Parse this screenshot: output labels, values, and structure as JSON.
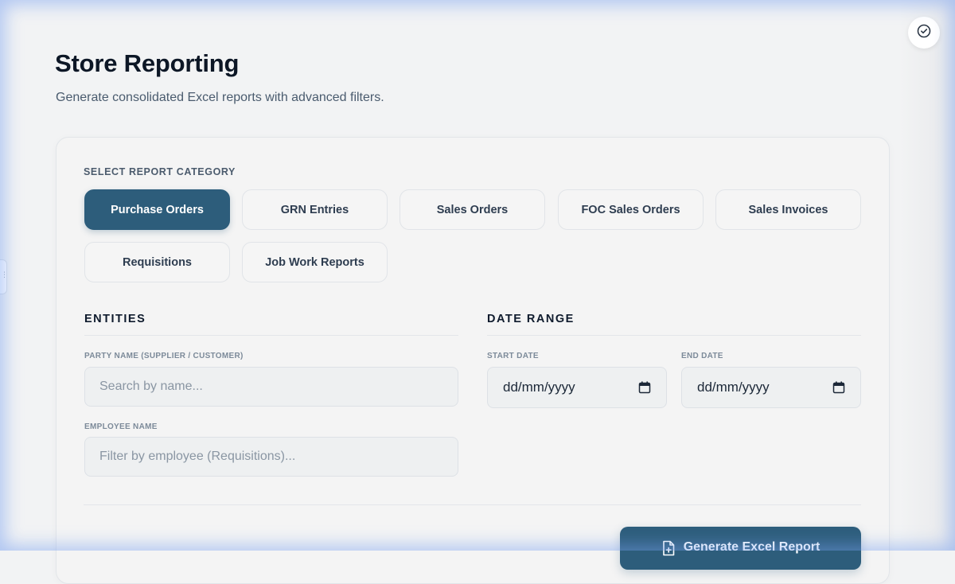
{
  "header": {
    "title": "Store Reporting",
    "subtitle": "Generate consolidated Excel reports with advanced filters."
  },
  "categories": {
    "caption": "SELECT REPORT CATEGORY",
    "selected": "Purchase Orders",
    "items": [
      {
        "label": "Purchase Orders"
      },
      {
        "label": "GRN Entries"
      },
      {
        "label": "Sales Orders"
      },
      {
        "label": "FOC Sales Orders"
      },
      {
        "label": "Sales Invoices"
      },
      {
        "label": "Requisitions"
      },
      {
        "label": "Job Work Reports"
      }
    ]
  },
  "entities": {
    "title": "ENTITIES",
    "party": {
      "label": "PARTY NAME (SUPPLIER / CUSTOMER)",
      "placeholder": "Search by name...",
      "value": ""
    },
    "employee": {
      "label": "EMPLOYEE NAME",
      "placeholder": "Filter by employee (Requisitions)...",
      "value": ""
    }
  },
  "date_range": {
    "title": "DATE RANGE",
    "start": {
      "label": "START DATE",
      "value": "dd/mm/yyyy"
    },
    "end": {
      "label": "END DATE",
      "value": "dd/mm/yyyy"
    }
  },
  "actions": {
    "generate_label": "Generate Excel Report"
  },
  "icons": {
    "top_right": "check-circle-icon",
    "calendar": "calendar-icon",
    "generate": "file-plus-icon"
  },
  "colors": {
    "accent": "#2d5d7b",
    "title": "#0d1726",
    "muted": "#4a5b6e"
  }
}
